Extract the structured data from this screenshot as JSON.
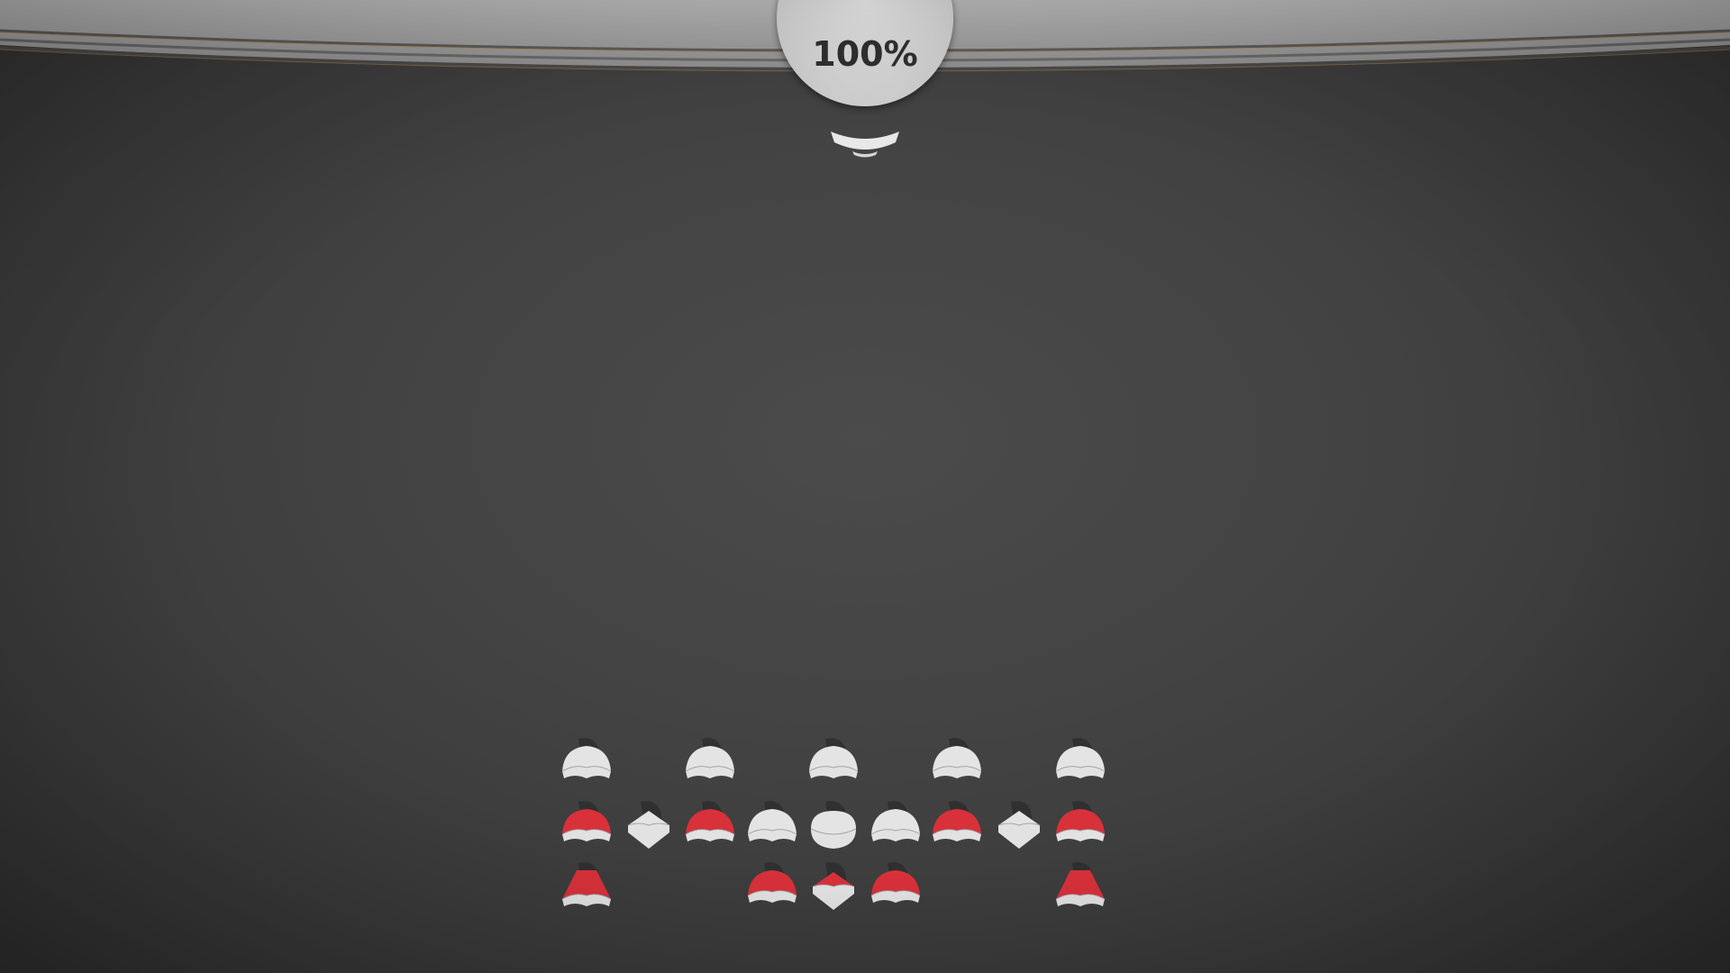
{
  "hud": {
    "health_percent_label": "100%",
    "health_percent": 100
  },
  "colors": {
    "background": "#404040",
    "invader_white": "#e4e4e4",
    "invader_red": "#d8313a",
    "dial": "#d6d6d6"
  },
  "invaders": {
    "rows": [
      [
        "white-dome",
        null,
        "white-dome",
        null,
        "white-dome",
        null,
        "white-dome",
        null,
        "white-dome"
      ],
      [
        "red-dome",
        "white-diamond",
        "red-dome",
        "white-dome",
        "white-round",
        "white-dome",
        "red-dome",
        "white-diamond",
        "red-dome"
      ],
      [
        "red-spike",
        null,
        null,
        "red-dome",
        "red-diamond",
        "red-dome",
        null,
        null,
        "red-spike"
      ]
    ],
    "row_offsets": [
      1,
      0,
      0
    ]
  }
}
